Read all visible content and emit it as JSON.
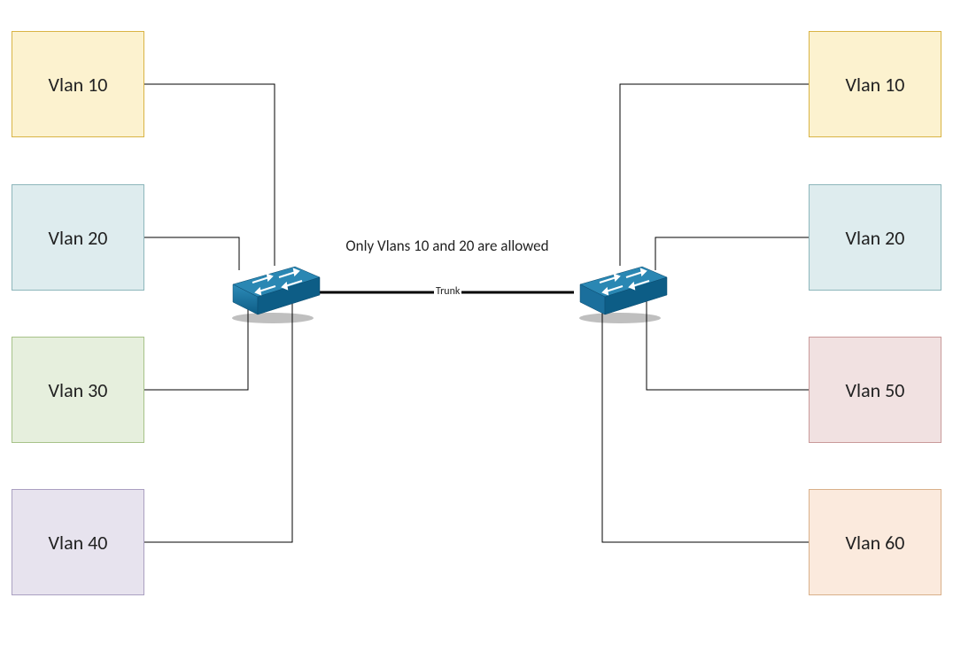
{
  "left": {
    "vlan10": "Vlan 10",
    "vlan20": "Vlan 20",
    "vlan30": "Vlan 30",
    "vlan40": "Vlan 40"
  },
  "right": {
    "vlan10": "Vlan 10",
    "vlan20": "Vlan 20",
    "vlan50": "Vlan 50",
    "vlan60": "Vlan 60"
  },
  "trunk": {
    "label": "Trunk",
    "caption": "Only Vlans 10 and 20 are allowed"
  }
}
